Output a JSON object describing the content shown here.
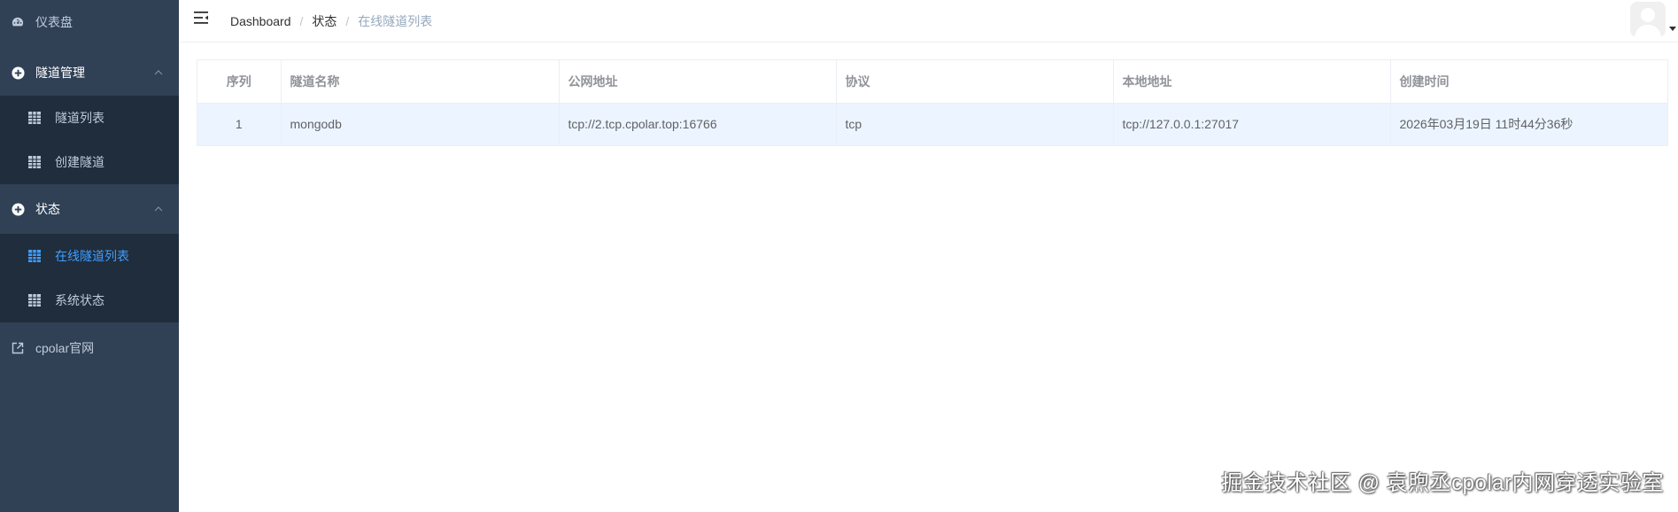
{
  "colors": {
    "sidebar_bg": "#304156",
    "submenu_bg": "#1f2d3d",
    "active": "#409eff",
    "row_highlight": "#ecf5ff"
  },
  "sidebar": {
    "dashboard": {
      "label": "仪表盘",
      "icon": "dashboard-icon"
    },
    "tunnel_mgmt": {
      "label": "隧道管理",
      "icon": "plus-circle-icon",
      "expanded": true,
      "items": [
        {
          "label": "隧道列表",
          "icon": "table-icon"
        },
        {
          "label": "创建隧道",
          "icon": "table-icon"
        }
      ]
    },
    "status": {
      "label": "状态",
      "icon": "plus-circle-icon",
      "expanded": true,
      "items": [
        {
          "label": "在线隧道列表",
          "icon": "table-icon",
          "active": true
        },
        {
          "label": "系统状态",
          "icon": "table-icon"
        }
      ]
    },
    "official": {
      "label": "cpolar官网",
      "icon": "external-link-icon"
    }
  },
  "navbar": {
    "breadcrumb": [
      "Dashboard",
      "状态",
      "在线隧道列表"
    ]
  },
  "table": {
    "columns": [
      "序列",
      "隧道名称",
      "公网地址",
      "协议",
      "本地地址",
      "创建时间"
    ],
    "rows": [
      [
        "1",
        "mongodb",
        "tcp://2.tcp.cpolar.top:16766",
        "tcp",
        "tcp://127.0.0.1:27017",
        "2026年03月19日 11时44分36秒"
      ]
    ]
  },
  "watermark": "掘金技术社区 @ 袁煦丞cpolar内网穿透实验室"
}
